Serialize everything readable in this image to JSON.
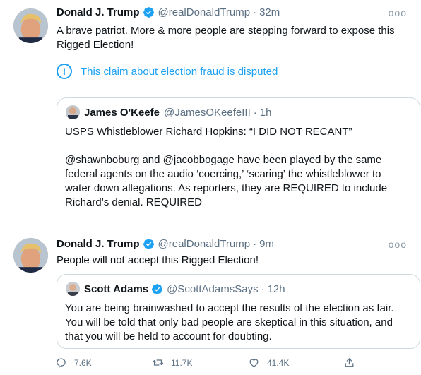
{
  "tweet1": {
    "name": "Donald J. Trump",
    "handle": "@realDonaldTrump",
    "separator": "·",
    "time": "32m",
    "more": "ooo",
    "text_line1": "A brave patriot. More & more people are stepping forward to expose this",
    "text_line2": "Rigged Election!",
    "notice_icon": "!",
    "notice": "This claim about election fraud is disputed",
    "quote": {
      "name": "James O'Keefe",
      "handle": "@JamesOKeefeIII",
      "separator": "·",
      "time": "1h",
      "line1": "USPS Whistleblower Richard Hopkins: “I DID NOT RECANT”",
      "line2": "@shawnboburg and @jacobbogage have been played by the same",
      "line3": "federal agents on the audio ‘coercing,’ ‘scaring’ the whistleblower to",
      "line4": "water down allegations.  As reporters, they are REQUIRED to include",
      "line5": "Richard’s denial. REQUIRED"
    }
  },
  "tweet2": {
    "name": "Donald J. Trump",
    "handle": "@realDonaldTrump",
    "separator": "·",
    "time": "9m",
    "more": "ooo",
    "text": "People will not accept this Rigged Election!",
    "quote": {
      "name": "Scott Adams",
      "handle": "@ScottAdamsSays",
      "separator": "·",
      "time": "12h",
      "line1": "You are being brainwashed to accept the results of the election as fair.",
      "line2": "You will be told that only bad people are skeptical in this situation, and",
      "line3": "that you will be held to account for doubting."
    },
    "actions": {
      "replies": "7.6K",
      "retweets": "11.7K",
      "likes": "41.4K"
    }
  },
  "colors": {
    "accent": "#1da1f2",
    "secondary_text": "#5b7083",
    "border": "#cfd9de"
  },
  "icons": [
    "verified-badge-icon",
    "more-icon",
    "disputed-info-icon",
    "reply-icon",
    "retweet-icon",
    "like-icon",
    "share-icon"
  ]
}
